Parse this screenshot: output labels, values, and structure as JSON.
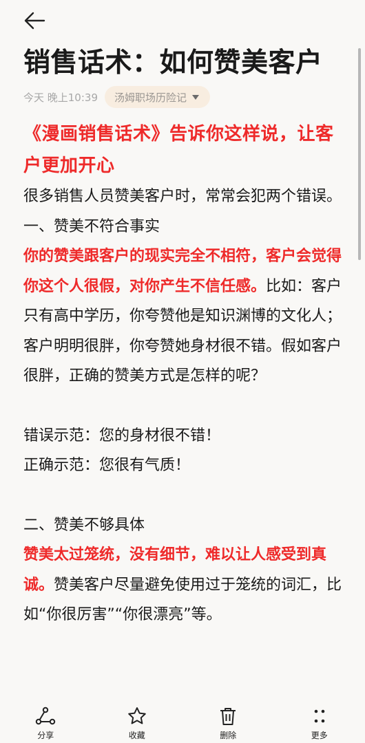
{
  "article": {
    "title": "销售话术：如何赞美客户",
    "time": "今天 晚上10:39",
    "source": "汤姆职场历险记",
    "headline": "《漫画销售话术》告诉你这样说，让客户更加开心",
    "intro": "很多销售人员赞美客户时，常常会犯两个错误。",
    "section1_heading": "一、赞美不符合事实",
    "section1_red": "你的赞美跟客户的现实完全不相符，客户会觉得你这个人很假，对你产生不信任感。",
    "section1_body": "比如：客户只有高中学历，你夸赞他是知识渊博的文化人；客户明明很胖，你夸赞她身材很不错。假如客户很胖，正确的赞美方式是怎样的呢？",
    "wrong_example": "错误示范：您的身材很不错！",
    "right_example": "正确示范：您很有气质！",
    "section2_heading": "二、赞美不够具体",
    "section2_red": "赞美太过笼统，没有细节，难以让人感受到真诚。",
    "section2_body": "赞美客户尽量避免使用过于笼统的词汇，比如“你很厉害”“你很漂亮”等。"
  },
  "toolbar": {
    "share": "分享",
    "favorite": "收藏",
    "delete": "删除",
    "more": "更多"
  }
}
